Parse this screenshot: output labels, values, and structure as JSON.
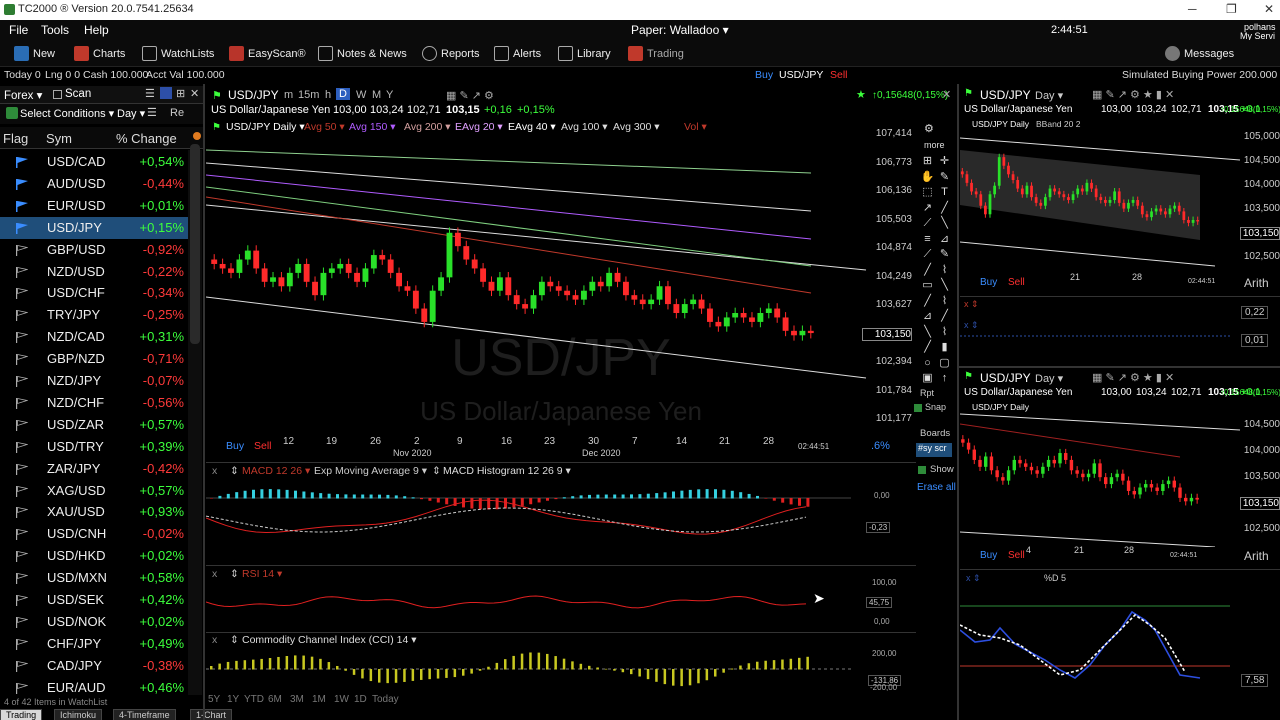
{
  "window": {
    "title": "TC2000 ® Version 20.0.7541.25634"
  },
  "menu": {
    "file": "File",
    "tools": "Tools",
    "help": "Help",
    "paper": "Paper: Walladoo ▾",
    "time": "2:44:51",
    "user1": "polhans",
    "user2": "My Servi"
  },
  "toolbar": {
    "new": "New",
    "charts": "Charts",
    "watchlists": "WatchLists",
    "easyscan": "EasyScan®",
    "notes": "Notes & News",
    "reports": "Reports",
    "alerts": "Alerts",
    "library": "Library",
    "trading": "Trading",
    "messages": "Messages"
  },
  "account": {
    "today": "Today 0",
    "lng": "Lng 0 0",
    "cash": "Cash 100.000",
    "acct": "Acct Val 100.000",
    "buy": "Buy",
    "symbol": "USD/JPY",
    "sell": "Sell",
    "sim": "Simulated Buying Power 200.000"
  },
  "watchlist": {
    "title": "Forex ▾",
    "scan": "Scan",
    "select_conditions": "Select Conditions ▾",
    "day": "Day ▾",
    "col_flag": "Flag",
    "col_sym": "Sym",
    "col_chg": "% Change",
    "footer": "4 of 42 Items in WatchList",
    "rows": [
      {
        "sym": "USD/CAD",
        "chg": "+0,54%",
        "up": true,
        "flag": "blue"
      },
      {
        "sym": "AUD/USD",
        "chg": "-0,44%",
        "up": false,
        "flag": "blue"
      },
      {
        "sym": "EUR/USD",
        "chg": "+0,01%",
        "up": true,
        "flag": "blue"
      },
      {
        "sym": "USD/JPY",
        "chg": "+0,15%",
        "up": true,
        "flag": "blue",
        "selected": true
      },
      {
        "sym": "GBP/USD",
        "chg": "-0,92%",
        "up": false,
        "flag": "outline"
      },
      {
        "sym": "NZD/USD",
        "chg": "-0,22%",
        "up": false,
        "flag": "outline"
      },
      {
        "sym": "USD/CHF",
        "chg": "-0,34%",
        "up": false,
        "flag": "outline"
      },
      {
        "sym": "TRY/JPY",
        "chg": "-0,25%",
        "up": false,
        "flag": "outline"
      },
      {
        "sym": "NZD/CAD",
        "chg": "+0,31%",
        "up": true,
        "flag": "outline"
      },
      {
        "sym": "GBP/NZD",
        "chg": "-0,71%",
        "up": false,
        "flag": "outline"
      },
      {
        "sym": "NZD/JPY",
        "chg": "-0,07%",
        "up": false,
        "flag": "outline"
      },
      {
        "sym": "NZD/CHF",
        "chg": "-0,56%",
        "up": false,
        "flag": "outline"
      },
      {
        "sym": "USD/ZAR",
        "chg": "+0,57%",
        "up": true,
        "flag": "outline"
      },
      {
        "sym": "USD/TRY",
        "chg": "+0,39%",
        "up": true,
        "flag": "outline"
      },
      {
        "sym": "ZAR/JPY",
        "chg": "-0,42%",
        "up": false,
        "flag": "outline"
      },
      {
        "sym": "XAG/USD",
        "chg": "+0,57%",
        "up": true,
        "flag": "outline"
      },
      {
        "sym": "XAU/USD",
        "chg": "+0,93%",
        "up": true,
        "flag": "outline"
      },
      {
        "sym": "USD/CNH",
        "chg": "-0,02%",
        "up": false,
        "flag": "outline"
      },
      {
        "sym": "USD/HKD",
        "chg": "+0,02%",
        "up": true,
        "flag": "outline"
      },
      {
        "sym": "USD/MXN",
        "chg": "+0,58%",
        "up": true,
        "flag": "outline"
      },
      {
        "sym": "USD/SEK",
        "chg": "+0,42%",
        "up": true,
        "flag": "outline"
      },
      {
        "sym": "USD/NOK",
        "chg": "+0,02%",
        "up": true,
        "flag": "outline"
      },
      {
        "sym": "CHF/JPY",
        "chg": "+0,49%",
        "up": true,
        "flag": "outline"
      },
      {
        "sym": "CAD/JPY",
        "chg": "-0,38%",
        "up": false,
        "flag": "outline"
      },
      {
        "sym": "EUR/AUD",
        "chg": "+0,46%",
        "up": true,
        "flag": "outline"
      }
    ]
  },
  "tabs": [
    "Trading",
    "Ichimoku",
    "4-Timeframe",
    "1-Chart"
  ],
  "main_chart": {
    "symbol": "USD/JPY",
    "timeframes": [
      "m",
      "15m",
      "h",
      "D",
      "W",
      "M",
      "Y"
    ],
    "change_hdr": "↑0,15648(0,15%)",
    "desc": "US Dollar/Japanese Yen",
    "o": "103,00",
    "h": "103,24",
    "l": "102,71",
    "c": "103,15",
    "chg": "+0,16",
    "pct": "+0,15%",
    "indicators": [
      "USD/JPY Daily ▾",
      "Avg 50 ▾",
      "Avg 150 ▾",
      "Avg 200 ▾",
      "EAvg 20 ▾",
      "EAvg 40 ▾",
      "Avg 100 ▾",
      "Avg 300 ▾",
      "Vol ▾"
    ],
    "watermark_sym": "USD/JPY",
    "watermark_name": "US Dollar/Japanese Yen",
    "buy": "Buy",
    "sell": "Sell",
    "time_stamp": "02:44:51",
    "pct_btn": ".6%",
    "more": "more",
    "x_ticks": [
      "12",
      "19",
      "26",
      "2",
      "9",
      "16",
      "23",
      "30",
      "7",
      "14",
      "21",
      "28"
    ],
    "x_months": [
      "Nov 2020",
      "Dec 2020"
    ],
    "macd": {
      "labels": [
        "MACD 12 26 ▾",
        "Exp Moving Average 9 ▾",
        "MACD Histogram 12 26 9 ▾"
      ],
      "axis": [
        "0,00",
        "-0,23"
      ]
    },
    "rsi": {
      "label": "RSI 14 ▾",
      "axis": [
        "100,00",
        "45,75",
        "0,00"
      ]
    },
    "cci": {
      "label": "Commodity Channel Index (CCI) 14 ▾",
      "axis": [
        "200,00",
        "-131,86",
        "-200,00"
      ]
    },
    "periods": [
      "5Y",
      "1Y",
      "YTD",
      "6M",
      "3M",
      "1M",
      "1W",
      "1D",
      "Today"
    ],
    "side_tools": [
      "Rpt",
      "Snap",
      "Boards",
      "Show",
      "Erase all"
    ],
    "chart_data": {
      "type": "candlestick",
      "title": "USD/JPY Daily",
      "y_ticks": [
        "107,414",
        "106,773",
        "106,136",
        "105,503",
        "104,874",
        "104,249",
        "103,627",
        "103,150",
        "102,394",
        "101,784",
        "101,177"
      ],
      "ylim": [
        101.177,
        107.414
      ],
      "last_close": 103.15,
      "series": [
        {
          "name": "USD/JPY",
          "close": [
            104.7,
            104.6,
            104.5,
            104.8,
            105.0,
            104.6,
            104.3,
            104.4,
            104.2,
            104.5,
            104.7,
            104.3,
            104.0,
            104.5,
            104.6,
            104.7,
            104.5,
            104.3,
            104.6,
            104.9,
            104.8,
            104.5,
            104.2,
            104.1,
            103.7,
            103.4,
            104.1,
            104.4,
            105.4,
            105.1,
            104.8,
            104.6,
            104.3,
            104.1,
            104.4,
            104.0,
            103.8,
            103.7,
            104.0,
            104.3,
            104.2,
            104.1,
            104.0,
            103.9,
            104.1,
            104.3,
            104.2,
            104.5,
            104.3,
            104.0,
            103.9,
            103.8,
            103.9,
            104.2,
            103.8,
            103.6,
            103.8,
            103.9,
            103.7,
            103.4,
            103.3,
            103.5,
            103.6,
            103.5,
            103.4,
            103.6,
            103.7,
            103.5,
            103.2,
            103.1,
            103.2,
            103.15
          ]
        }
      ]
    }
  },
  "right_top": {
    "symbol": "USD/JPY",
    "tf": "Day ▾",
    "desc": "US Dollar/Japanese Yen",
    "o": "103,00",
    "h": "103,24",
    "l": "102,71",
    "c": "103,15",
    "chg": "+0,1",
    "pct": "↑0,15648(0,15%)",
    "ind": "USD/JPY Daily",
    "ind2": "BBand 20 2",
    "y_ticks": [
      "105,000",
      "104,500",
      "104,000",
      "103,500",
      "103,150",
      "102,500"
    ],
    "x_ticks": [
      "21",
      "28"
    ],
    "time": "02:44:51",
    "arith": "Arith",
    "buy": "Buy",
    "sell": "Sell",
    "sub_axis": [
      "0,22",
      "0,01"
    ]
  },
  "right_bottom": {
    "symbol": "USD/JPY",
    "tf": "Day ▾",
    "desc": "US Dollar/Japanese Yen",
    "o": "103,00",
    "h": "103,24",
    "l": "102,71",
    "c": "103,15",
    "chg": "+0,1",
    "pct": "↑0,15648(0,15%)",
    "ind": "USD/JPY Daily",
    "y_ticks": [
      "104,500",
      "104,000",
      "103,500",
      "103,150",
      "102,500"
    ],
    "x_ticks": [
      "4",
      "21",
      "28"
    ],
    "time": "02:44:51",
    "arith": "Arith",
    "buy": "Buy",
    "sell": "Sell",
    "stoch": "%D 5",
    "stoch_val": "7,58",
    "watermark_sym": "USD/JPY",
    "watermark_name": "US Dollar/Japanese Yen"
  }
}
